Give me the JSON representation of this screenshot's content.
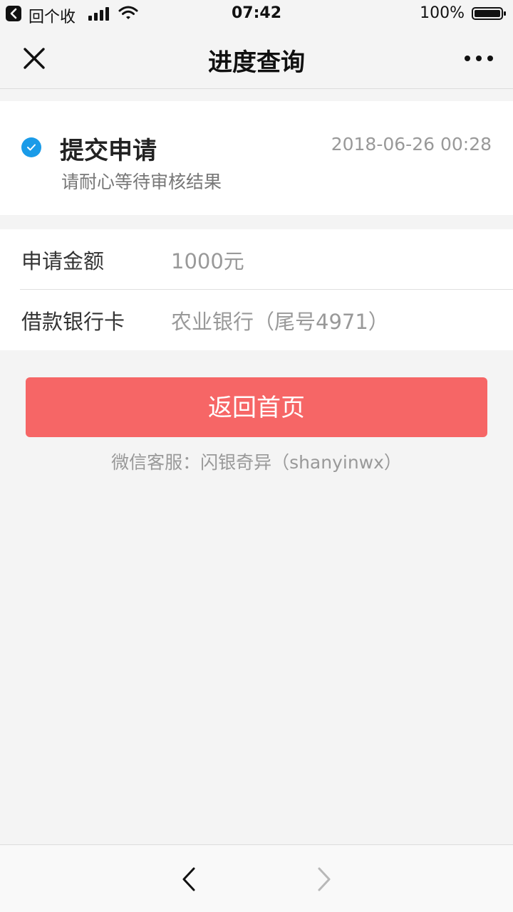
{
  "status_bar": {
    "back_label": "回个收",
    "time": "07:42",
    "battery": "100%",
    "icons": [
      "back-app-icon",
      "signal-icon",
      "wifi-icon",
      "battery-icon"
    ]
  },
  "nav": {
    "title": "进度查询",
    "close_icon": "close-icon",
    "more_icon": "more-icon"
  },
  "status": {
    "title": "提交申请",
    "time": "2018-06-26 00:28",
    "subtitle": "请耐心等待审核结果",
    "icon": "check-circle-icon",
    "icon_color": "#1a9be8"
  },
  "info": {
    "rows": [
      {
        "label": "申请金额",
        "value": "1000元"
      },
      {
        "label": "借款银行卡",
        "value": "农业银行（尾号4971）"
      }
    ]
  },
  "actions": {
    "home_button_label": "返回首页",
    "home_button_color": "#f66666",
    "service_text": "微信客服：闪银奇异（shanyinwx）"
  },
  "toolbar": {
    "back_icon": "chevron-left-icon",
    "forward_icon": "chevron-right-icon"
  }
}
